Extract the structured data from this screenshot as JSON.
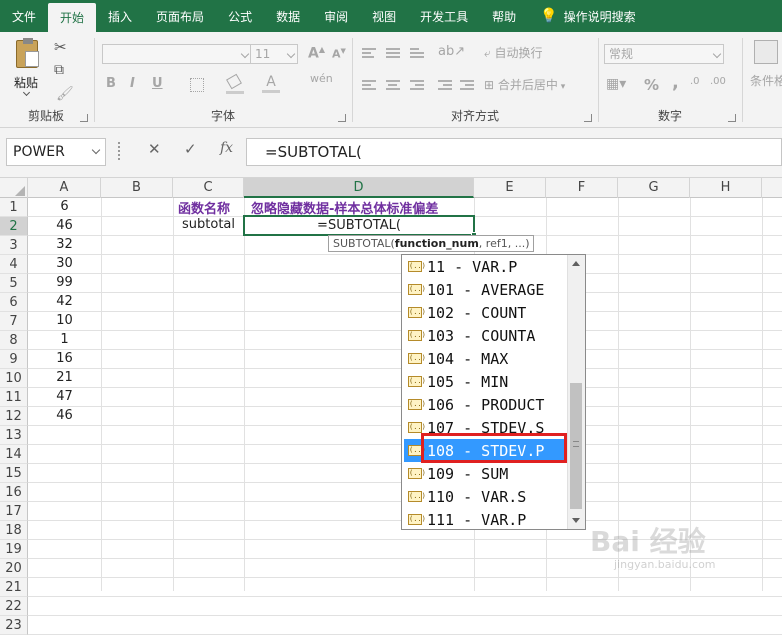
{
  "ribbon_tabs": [
    {
      "label": "文件"
    },
    {
      "label": "开始"
    },
    {
      "label": "插入"
    },
    {
      "label": "页面布局"
    },
    {
      "label": "公式"
    },
    {
      "label": "数据"
    },
    {
      "label": "审阅"
    },
    {
      "label": "视图"
    },
    {
      "label": "开发工具"
    },
    {
      "label": "帮助"
    }
  ],
  "active_tab": "开始",
  "tell_me": "操作说明搜索",
  "ribbon": {
    "clipboard": {
      "label": "剪贴板",
      "paste": "粘贴"
    },
    "font": {
      "label": "字体",
      "size": "11",
      "bold": "B",
      "italic": "I",
      "underline": "U",
      "phonetic": "wén"
    },
    "alignment": {
      "label": "对齐方式",
      "wrap": "自动换行",
      "merge": "合并后居中"
    },
    "number": {
      "label": "数字",
      "format": "常规",
      "percent": "%",
      "comma": ","
    },
    "styles": {
      "conditional": "条件格"
    }
  },
  "formula_bar": {
    "name_box": "POWER",
    "cancel": "✕",
    "enter": "✓",
    "fx": "fx",
    "content": "=SUBTOTAL("
  },
  "columns": [
    "A",
    "B",
    "C",
    "D",
    "E",
    "F",
    "G",
    "H"
  ],
  "rows": [
    "1",
    "2",
    "3",
    "4",
    "5",
    "6",
    "7",
    "8",
    "9",
    "10",
    "11",
    "12",
    "13",
    "14",
    "15",
    "16",
    "17",
    "18",
    "19",
    "20",
    "21",
    "22",
    "23"
  ],
  "column_a_values": [
    "6",
    "46",
    "32",
    "30",
    "99",
    "42",
    "10",
    "1",
    "16",
    "21",
    "47",
    "46"
  ],
  "cells": {
    "c1": "函数名称",
    "d1": "忽略隐藏数据-样本总体标准偏差",
    "c2": "subtotal",
    "d2": "=SUBTOTAL("
  },
  "tooltip": {
    "func": "SUBTOTAL(",
    "arg": "function_num",
    "rest": ", ref1, ...)"
  },
  "dropdown": {
    "items": [
      "11 - VAR.P",
      "101 - AVERAGE",
      "102 - COUNT",
      "103 - COUNTA",
      "104 - MAX",
      "105 - MIN",
      "106 - PRODUCT",
      "107 - STDEV.S",
      "108 - STDEV.P",
      "109 - SUM",
      "110 - VAR.S",
      "111 - VAR.P"
    ],
    "selected_index": 8
  },
  "watermark": {
    "logo": "Bai 经验",
    "url": "jingyan.baidu.com"
  },
  "colors": {
    "accent": "#217346",
    "selection": "#3399ff",
    "highlight_border": "#e02020",
    "header_text": "#7030a0"
  }
}
